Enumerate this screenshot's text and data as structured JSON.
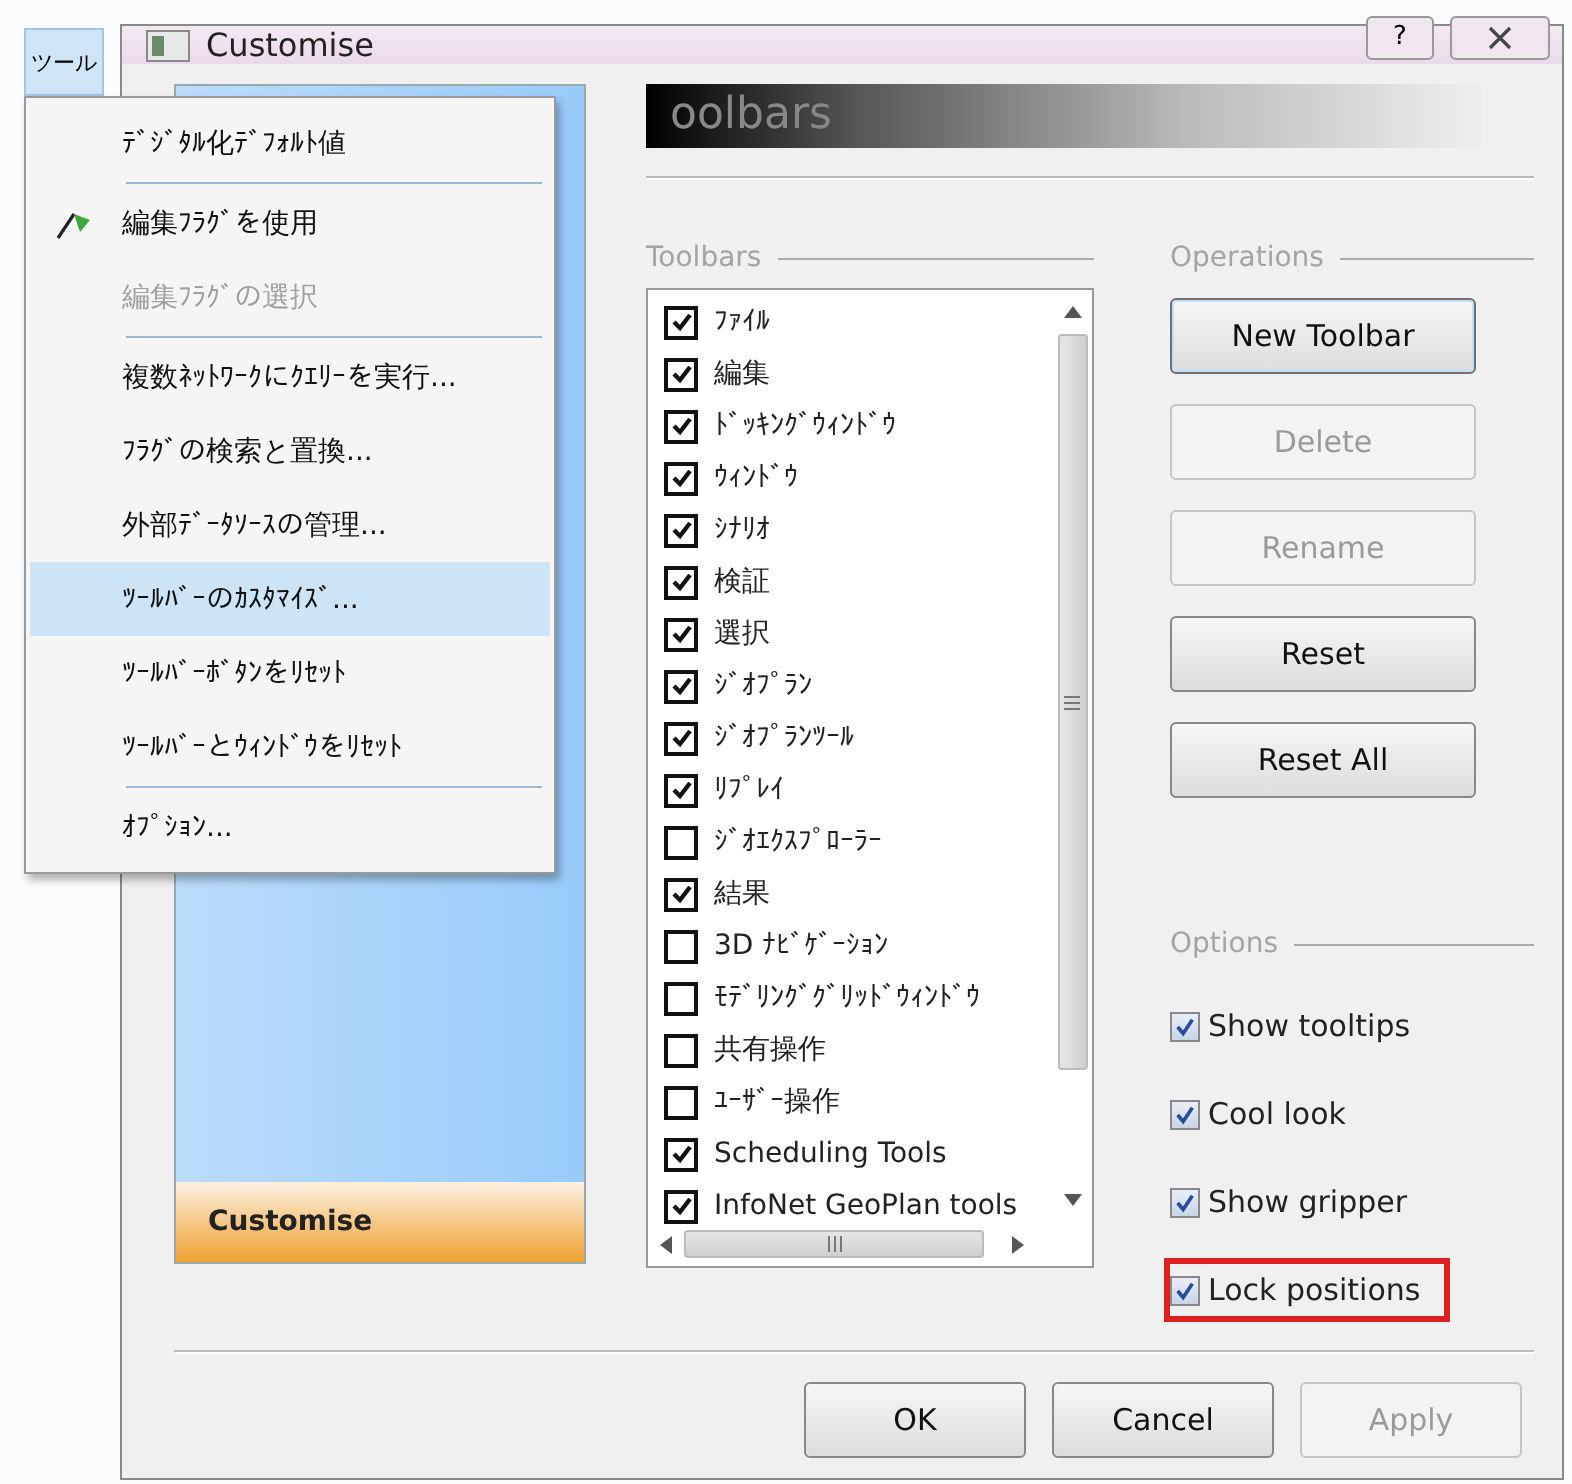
{
  "menu_button": {
    "label": "ツール",
    "selected": true
  },
  "window": {
    "title": "Customise",
    "help": "?"
  },
  "menu": [
    {
      "label": "ﾃﾞｼﾞﾀﾙ化ﾃﾞﾌｫﾙﾄ値",
      "kind": "plain",
      "disabled": false,
      "selected": false,
      "separator_after": true
    },
    {
      "label": "編集ﾌﾗｸﾞを使用",
      "kind": "flag",
      "disabled": false,
      "selected": false,
      "separator_after": false
    },
    {
      "label": "編集ﾌﾗｸﾞの選択",
      "kind": "plain",
      "disabled": true,
      "selected": false,
      "separator_after": true
    },
    {
      "label": "複数ﾈｯﾄﾜｰｸにｸｴﾘｰを実行...",
      "kind": "plain",
      "disabled": false,
      "selected": false,
      "separator_after": false
    },
    {
      "label": "ﾌﾗｸﾞの検索と置換...",
      "kind": "plain",
      "disabled": false,
      "selected": false,
      "separator_after": false
    },
    {
      "label": "外部ﾃﾞｰﾀｿｰｽの管理...",
      "kind": "plain",
      "disabled": false,
      "selected": false,
      "separator_after": false
    },
    {
      "label": "ﾂｰﾙﾊﾞｰのｶｽﾀﾏｲｽﾞ...",
      "kind": "plain",
      "disabled": false,
      "selected": true,
      "separator_after": false
    },
    {
      "label": "ﾂｰﾙﾊﾞｰﾎﾞﾀﾝをﾘｾｯﾄ",
      "kind": "plain",
      "disabled": false,
      "selected": false,
      "separator_after": false
    },
    {
      "label": "ﾂｰﾙﾊﾞｰとｳｨﾝﾄﾞｳをﾘｾｯﾄ",
      "kind": "plain",
      "disabled": false,
      "selected": false,
      "separator_after": true
    },
    {
      "label": "ｵﾌﾟｼｮﾝ...",
      "kind": "plain",
      "disabled": false,
      "selected": false,
      "separator_after": false
    }
  ],
  "sidebar": {
    "footer": "Customise"
  },
  "page_header": "oolbars",
  "toolbars_group": {
    "label": "Toolbars",
    "items": [
      {
        "label": "ﾌｧｲﾙ",
        "checked": true
      },
      {
        "label": "編集",
        "checked": true
      },
      {
        "label": "ﾄﾞｯｷﾝｸﾞｳｨﾝﾄﾞｳ",
        "checked": true
      },
      {
        "label": "ｳｨﾝﾄﾞｳ",
        "checked": true
      },
      {
        "label": "ｼﾅﾘｵ",
        "checked": true
      },
      {
        "label": "検証",
        "checked": true
      },
      {
        "label": "選択",
        "checked": true
      },
      {
        "label": "ｼﾞｵﾌﾟﾗﾝ",
        "checked": true
      },
      {
        "label": "ｼﾞｵﾌﾟﾗﾝﾂｰﾙ",
        "checked": true
      },
      {
        "label": "ﾘﾌﾟﾚｲ",
        "checked": true
      },
      {
        "label": "ｼﾞｵｴｸｽﾌﾟﾛｰﾗｰ",
        "checked": false
      },
      {
        "label": "結果",
        "checked": true
      },
      {
        "label": "3D ﾅﾋﾞｹﾞｰｼｮﾝ",
        "checked": false
      },
      {
        "label": "ﾓﾃﾞﾘﾝｸﾞｸﾞﾘｯﾄﾞｳｨﾝﾄﾞｳ",
        "checked": false
      },
      {
        "label": "共有操作",
        "checked": false
      },
      {
        "label": "ﾕｰｻﾞｰ操作",
        "checked": false
      },
      {
        "label": "Scheduling Tools",
        "checked": true
      },
      {
        "label": "InfoNet GeoPlan tools",
        "checked": true
      }
    ]
  },
  "operations_group": {
    "label": "Operations",
    "buttons": [
      {
        "label": "New Toolbar",
        "disabled": false,
        "focused": true
      },
      {
        "label": "Delete",
        "disabled": true,
        "focused": false
      },
      {
        "label": "Rename",
        "disabled": true,
        "focused": false
      },
      {
        "label": "Reset",
        "disabled": false,
        "focused": false
      },
      {
        "label": "Reset All",
        "disabled": false,
        "focused": false
      }
    ]
  },
  "options_group": {
    "label": "Options",
    "items": [
      {
        "label": "Show tooltips",
        "checked": true,
        "highlighted": false
      },
      {
        "label": "Cool look",
        "checked": true,
        "highlighted": false
      },
      {
        "label": "Show gripper",
        "checked": true,
        "highlighted": false
      },
      {
        "label": "Lock positions",
        "checked": true,
        "highlighted": true
      }
    ]
  },
  "footer_buttons": [
    {
      "label": "OK",
      "disabled": false
    },
    {
      "label": "Cancel",
      "disabled": false
    },
    {
      "label": "Apply",
      "disabled": true
    }
  ]
}
